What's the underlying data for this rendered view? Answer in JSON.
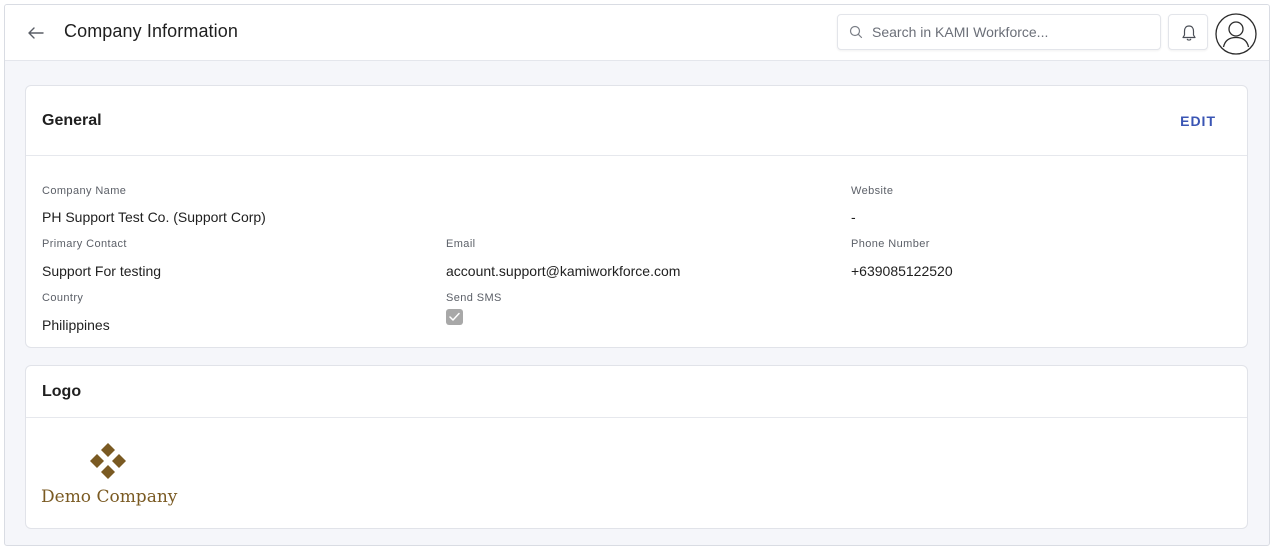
{
  "header": {
    "title": "Company Information",
    "search_placeholder": "Search in KAMI Workforce..."
  },
  "general": {
    "title": "General",
    "edit_label": "EDIT",
    "fields": {
      "company_name": {
        "label": "Company Name",
        "value": "PH Support Test Co. (Support Corp)"
      },
      "website": {
        "label": "Website",
        "value": "-"
      },
      "primary_contact": {
        "label": "Primary Contact",
        "value": "Support For testing"
      },
      "email": {
        "label": "Email",
        "value": "account.support@kamiworkforce.com"
      },
      "phone": {
        "label": "Phone Number",
        "value": "+639085122520"
      },
      "country": {
        "label": "Country",
        "value": "Philippines"
      },
      "send_sms": {
        "label": "Send SMS",
        "checked": true
      }
    }
  },
  "logo_section": {
    "title": "Logo",
    "logo_text": "Demo Company"
  },
  "colors": {
    "accent": "#3a55b4",
    "logo_brown": "#7a5a22",
    "background": "#f5f6fa"
  }
}
